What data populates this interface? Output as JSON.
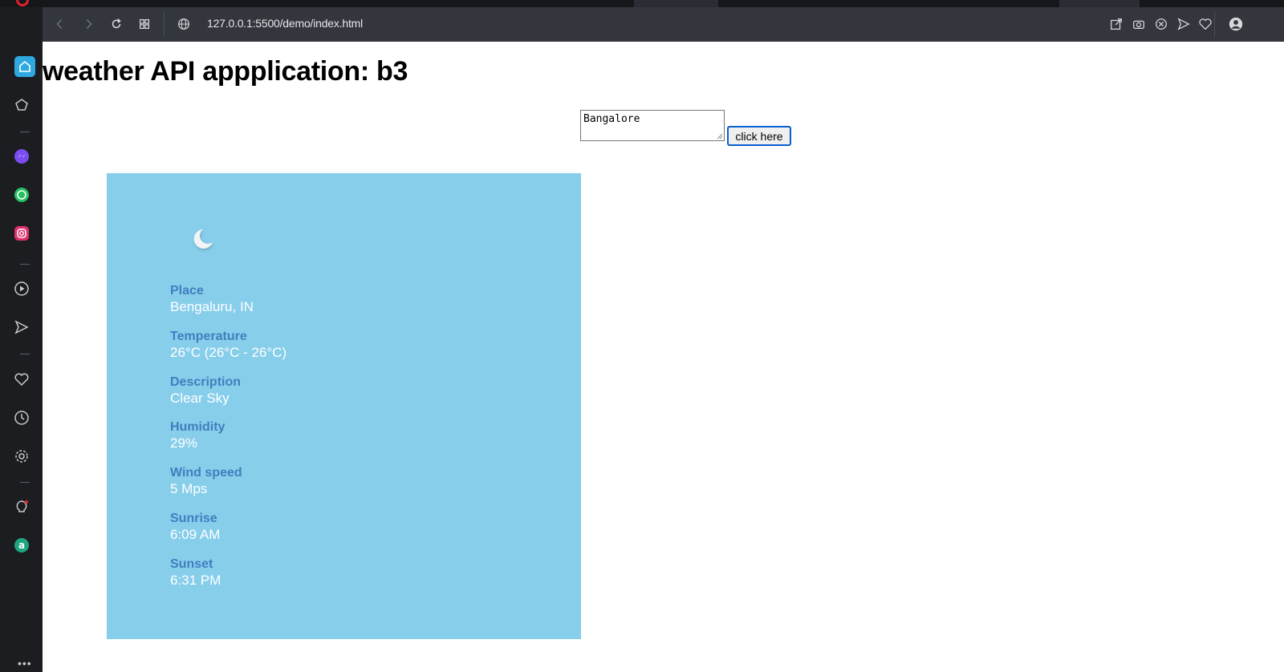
{
  "browser": {
    "url": "127.0.0.1:5500/demo/index.html"
  },
  "page": {
    "title": "weather API appplication: b3"
  },
  "search": {
    "input_value": "Bangalore",
    "button_label": "click here"
  },
  "weather": {
    "icon": "moon-icon",
    "fields": [
      {
        "label": "Place",
        "value": "Bengaluru, IN"
      },
      {
        "label": "Temperature",
        "value": "26°C (26°C - 26°C)"
      },
      {
        "label": "Description",
        "value": "Clear Sky"
      },
      {
        "label": "Humidity",
        "value": "29%"
      },
      {
        "label": "Wind speed",
        "value": "5 Mps"
      },
      {
        "label": "Sunrise",
        "value": "6:09 AM"
      },
      {
        "label": "Sunset",
        "value": "6:31 PM"
      }
    ]
  },
  "colors": {
    "card_background": "#87ceeb",
    "label_color": "#3f7fbf",
    "value_color": "#ffffff",
    "sidebar_accent": "#2fa8e0"
  }
}
